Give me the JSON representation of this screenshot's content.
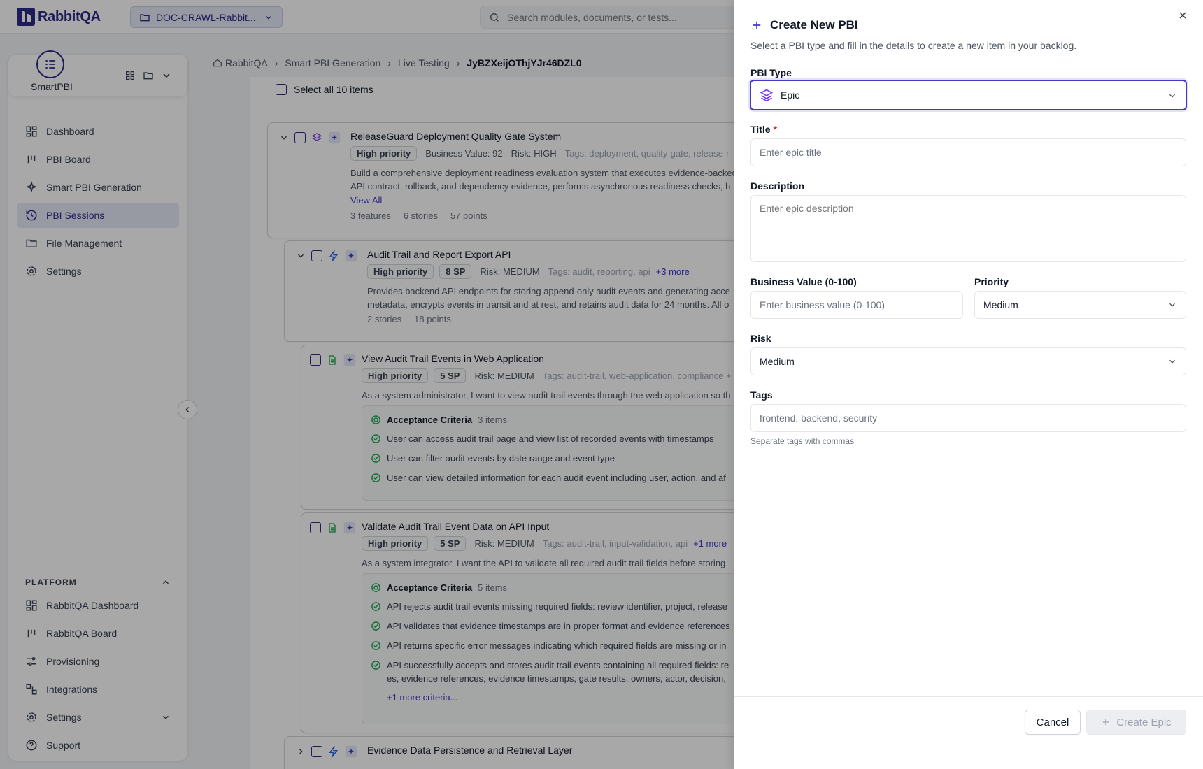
{
  "topbar": {
    "logo_text": "RabbitQA",
    "project": "DOC-CRAWL-Rabbit...",
    "search_placeholder": "Search modules, documents, or tests..."
  },
  "sidebar": {
    "app_name": "SmartPBI",
    "nav": [
      {
        "label": "Dashboard",
        "icon": "grid-icon"
      },
      {
        "label": "PBI Board",
        "icon": "board-icon"
      },
      {
        "label": "Smart PBI Generation",
        "icon": "sparkle-icon"
      },
      {
        "label": "PBI Sessions",
        "icon": "history-icon",
        "active": true
      },
      {
        "label": "File Management",
        "icon": "folder-icon"
      },
      {
        "label": "Settings",
        "icon": "gear-icon"
      }
    ],
    "platform_label": "PLATFORM",
    "platform": [
      {
        "label": "RabbitQA Dashboard",
        "icon": "grid-icon"
      },
      {
        "label": "RabbitQA Board",
        "icon": "board-icon"
      },
      {
        "label": "Provisioning",
        "icon": "sliders-icon"
      },
      {
        "label": "Integrations",
        "icon": "integrations-icon"
      },
      {
        "label": "Settings",
        "icon": "gear-icon"
      },
      {
        "label": "Support",
        "icon": "help-icon"
      }
    ]
  },
  "breadcrumb": [
    "RabbitQA",
    "Smart PBI Generation",
    "Live Testing",
    "JyBZXeijOThjYJr46DZL0"
  ],
  "main": {
    "select_all": "Select all 10 items",
    "epic": {
      "title": "ReleaseGuard Deployment Quality Gate System",
      "priority": "High priority",
      "business_value": "Business Value: 92",
      "risk": "Risk: HIGH",
      "tags": "Tags: deployment, quality-gate, release-r",
      "desc1": "Build a comprehensive deployment readiness evaluation system that executes evidence-backed",
      "desc2": "API contract, rollback, and dependency evidence, performs asynchronous readiness checks, h",
      "view_all": "View All",
      "features": "3 features",
      "stories": "6 stories",
      "points": "57 points"
    },
    "feature": {
      "title": "Audit Trail and Report Export API",
      "priority": "High priority",
      "sp": "8 SP",
      "risk": "Risk: MEDIUM",
      "tags": "Tags: audit, reporting, api",
      "more": "+3 more",
      "desc1": "Provides backend API endpoints for storing append-only audit events and generating acce",
      "desc2": "metadata, encrypts events in transit and at rest, and retains audit data for 24 months. All o",
      "stories": "2 stories",
      "points": "18 points"
    },
    "story1": {
      "title": "View Audit Trail Events in Web Application",
      "priority": "High priority",
      "sp": "5 SP",
      "risk": "Risk: MEDIUM",
      "tags": "Tags: audit-trail, web-application, compliance +",
      "desc": "As a system administrator, I want to view audit trail events through the web application so th",
      "ac_label": "Acceptance Criteria",
      "ac_count": "3 items",
      "criteria": [
        "User can access audit trail page and view list of recorded events with timestamps",
        "User can filter audit events by date range and event type",
        "User can view detailed information for each audit event including user, action, and af"
      ]
    },
    "story2": {
      "title": "Validate Audit Trail Event Data on API Input",
      "priority": "High priority",
      "sp": "5 SP",
      "risk": "Risk: MEDIUM",
      "tags": "Tags: audit-trail, input-validation, api",
      "more": "+1 more",
      "desc": "As a system integrator, I want the API to validate all required audit trail fields before storing",
      "ac_label": "Acceptance Criteria",
      "ac_count": "5 items",
      "criteria": [
        "API rejects audit trail events missing required fields: review identifier, project, release",
        "API validates that evidence timestamps are in proper format and evidence references",
        "API returns specific error messages indicating which required fields are missing or in",
        "API successfully accepts and stores audit trail events containing all required fields: re"
      ],
      "criteria4_cont": "es, evidence references, evidence timestamps, gate results, owners, actor, decision,",
      "more_criteria": "+1 more criteria..."
    },
    "feature2": {
      "title": "Evidence Data Persistence and Retrieval Layer"
    }
  },
  "panel": {
    "title": "Create New PBI",
    "subtitle": "Select a PBI type and fill in the details to create a new item in your backlog.",
    "type_label": "PBI Type",
    "type_value": "Epic",
    "title_label": "Title",
    "title_required": "*",
    "title_placeholder": "Enter epic title",
    "desc_label": "Description",
    "desc_placeholder": "Enter epic description",
    "bv_label": "Business Value (0-100)",
    "bv_placeholder": "Enter business value (0-100)",
    "priority_label": "Priority",
    "priority_value": "Medium",
    "risk_label": "Risk",
    "risk_value": "Medium",
    "tags_label": "Tags",
    "tags_placeholder": "frontend, backend, security",
    "tags_hint": "Separate tags with commas",
    "cancel": "Cancel",
    "create": "Create Epic"
  }
}
